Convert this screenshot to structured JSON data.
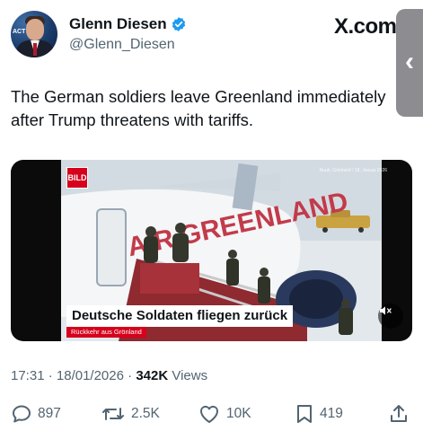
{
  "author": {
    "display_name": "Glenn Diesen",
    "handle": "@Glenn_Diesen",
    "verified": true,
    "avatar_icon": "profile-photo",
    "avatar_tag": "ACT"
  },
  "header": {
    "x_logo": "X.com",
    "side_tab_icon": "chevron-left-icon"
  },
  "tweet": {
    "text": "The German soldiers leave Greenland immediately after Trump threatens with tariffs."
  },
  "media": {
    "logo": "BILD",
    "corner_caption": "Nuuk, Grönland / 18. Januar 2026",
    "headline": "Deutsche Soldaten fliegen zurück",
    "subline": "Rückkehr aus Grönland",
    "mute_icon": "speaker-muted-icon"
  },
  "meta": {
    "time": "17:31",
    "date": "18/01/2026",
    "separator": "·",
    "views_count": "342K",
    "views_label": "Views"
  },
  "actions": {
    "replies": "897",
    "reposts": "2.5K",
    "likes": "10K",
    "bookmarks": "419"
  },
  "colors": {
    "text": "#0f1419",
    "secondary": "#536471",
    "verified": "#1d9bf0",
    "bild_red": "#d6001c"
  }
}
